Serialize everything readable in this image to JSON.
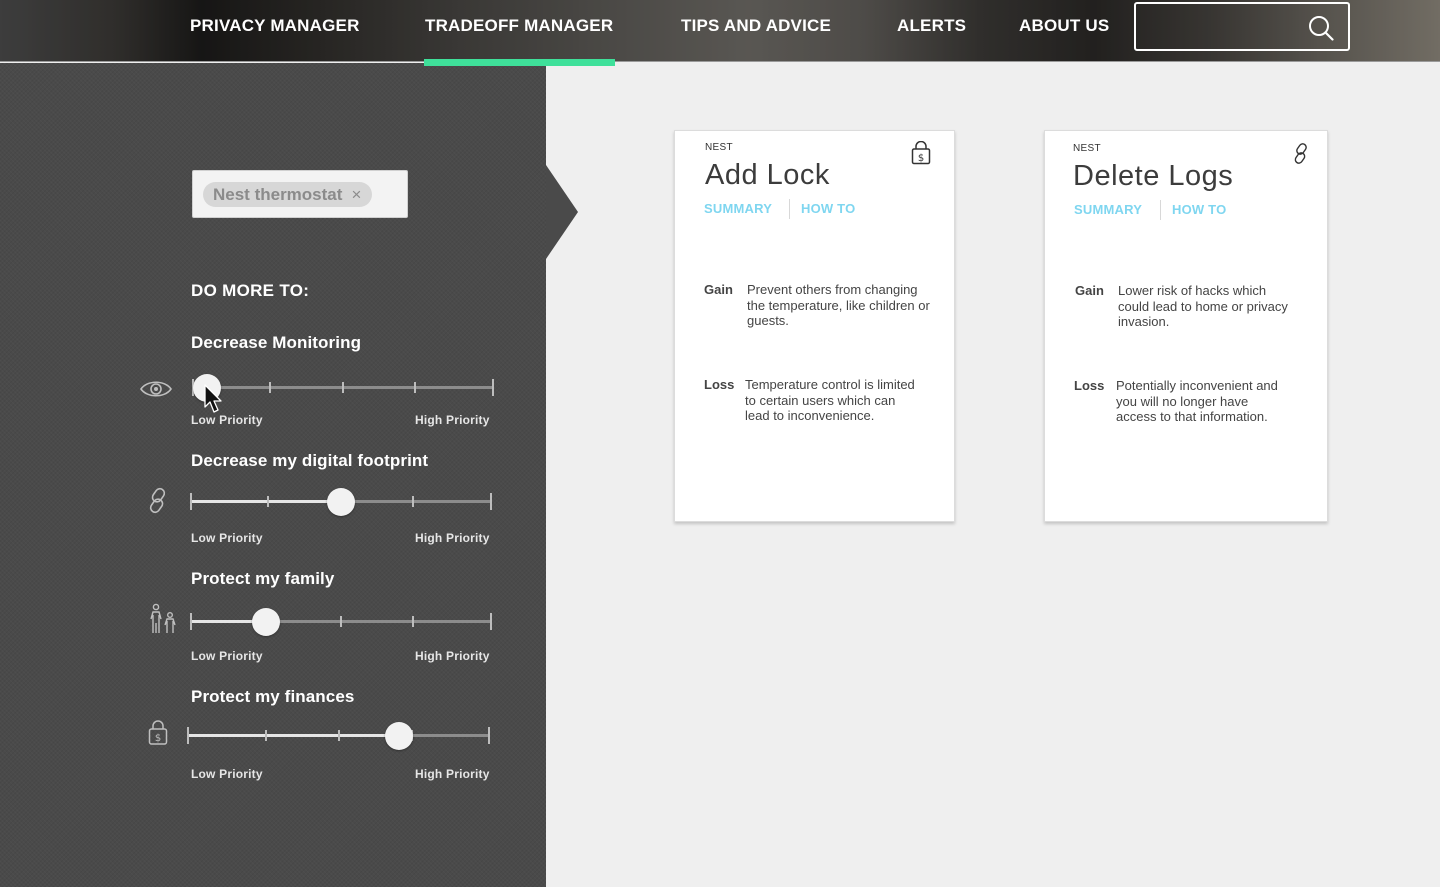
{
  "nav": {
    "items": [
      {
        "label": "PRIVACY MANAGER"
      },
      {
        "label": "TRADEOFF MANAGER",
        "active": true
      },
      {
        "label": "TIPS AND ADVICE"
      },
      {
        "label": "ALERTS"
      },
      {
        "label": "ABOUT US"
      }
    ],
    "search": {
      "value": "",
      "icon": "search-icon"
    },
    "accent_color": "#3fe09a"
  },
  "sidebar": {
    "selected_device": "Nest thermostat",
    "section_title": "DO MORE TO:",
    "sliders": [
      {
        "label": "Decrease Monitoring",
        "icon": "eye-icon",
        "value": 0.05,
        "low_label": "Low Priority",
        "high_label": "High Priority"
      },
      {
        "label": "Decrease my digital footprint",
        "icon": "link-icon",
        "value": 0.5,
        "low_label": "Low Priority",
        "high_label": "High Priority"
      },
      {
        "label": "Protect my family",
        "icon": "family-icon",
        "value": 0.25,
        "low_label": "Low Priority",
        "high_label": "High Priority"
      },
      {
        "label": "Protect my finances",
        "icon": "finance-lock-icon",
        "value": 0.7,
        "low_label": "Low Priority",
        "high_label": "High Priority"
      }
    ]
  },
  "cards": [
    {
      "brand": "NEST",
      "title": "Add Lock",
      "icon": "lock-dollar-icon",
      "tabs": [
        "SUMMARY",
        "HOW TO"
      ],
      "gain_label": "Gain",
      "gain": "Prevent others from changing the temperature, like children or guests.",
      "loss_label": "Loss",
      "loss": "Temperature control is limited to certain users which can lead to inconvenience."
    },
    {
      "brand": "NEST",
      "title": "Delete Logs",
      "icon": "link-icon",
      "tabs": [
        "SUMMARY",
        "HOW TO"
      ],
      "gain_label": "Gain",
      "gain": "Lower risk of hacks which could lead to home or privacy invasion.",
      "loss_label": "Loss",
      "loss": "Potentially inconvenient and you will no longer have access to that information."
    }
  ],
  "colors": {
    "tab_link": "#7fd6f0",
    "sidebar_bg": "#4a4a4a",
    "content_bg": "#efefef"
  }
}
